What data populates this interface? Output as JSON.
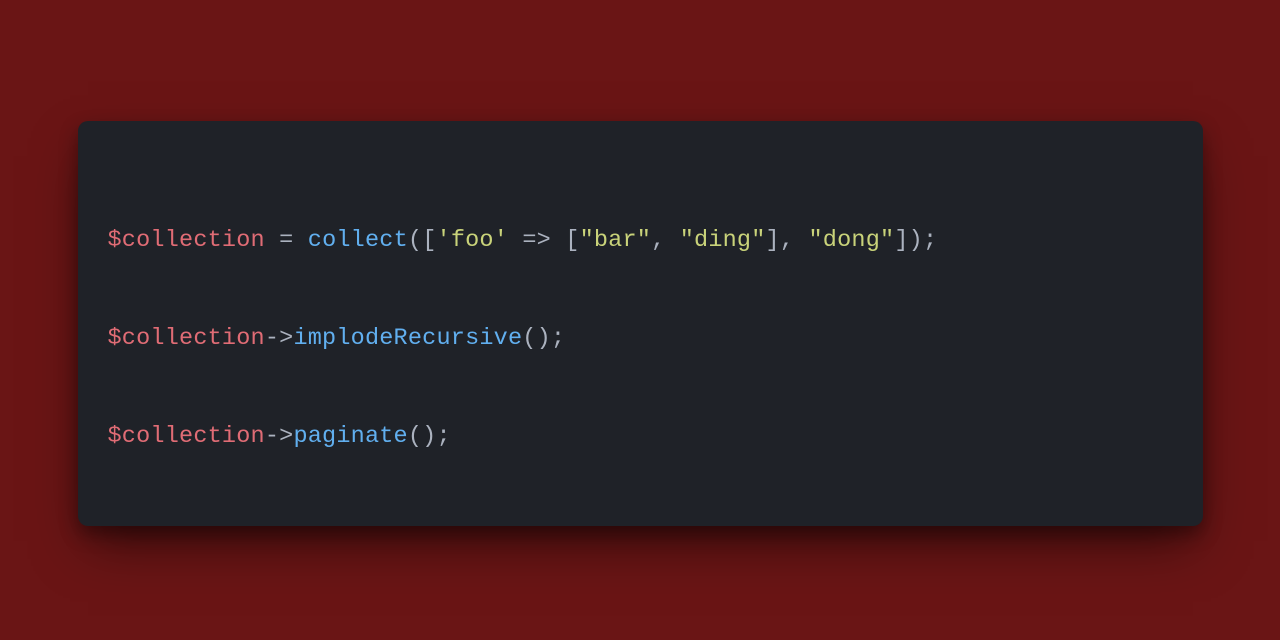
{
  "colors": {
    "background": "#6a1515",
    "card": "#1f2228",
    "default": "#abb2bf",
    "variable": "#e06c75",
    "function": "#61afef",
    "string": "#c9d37a"
  },
  "code": {
    "line1": {
      "var": "$collection",
      "sp1": " ",
      "eq": "=",
      "sp2": " ",
      "fn": "collect",
      "open_paren": "(",
      "open_bracket": "[",
      "str_key": "'foo'",
      "sp3": " ",
      "fat_arrow": "=>",
      "sp4": " ",
      "open_bracket2": "[",
      "str_bar": "\"bar\"",
      "comma1": ",",
      "sp5": " ",
      "str_ding": "\"ding\"",
      "close_bracket2": "]",
      "comma2": ",",
      "sp6": " ",
      "str_dong": "\"dong\"",
      "close_bracket": "]",
      "close_paren": ")",
      "semi": ";"
    },
    "line2": {
      "var": "$collection",
      "arrow": "->",
      "fn": "implodeRecursive",
      "open_paren": "(",
      "close_paren": ")",
      "semi": ";"
    },
    "line3": {
      "var": "$collection",
      "arrow": "->",
      "fn": "paginate",
      "open_paren": "(",
      "close_paren": ")",
      "semi": ";"
    }
  }
}
